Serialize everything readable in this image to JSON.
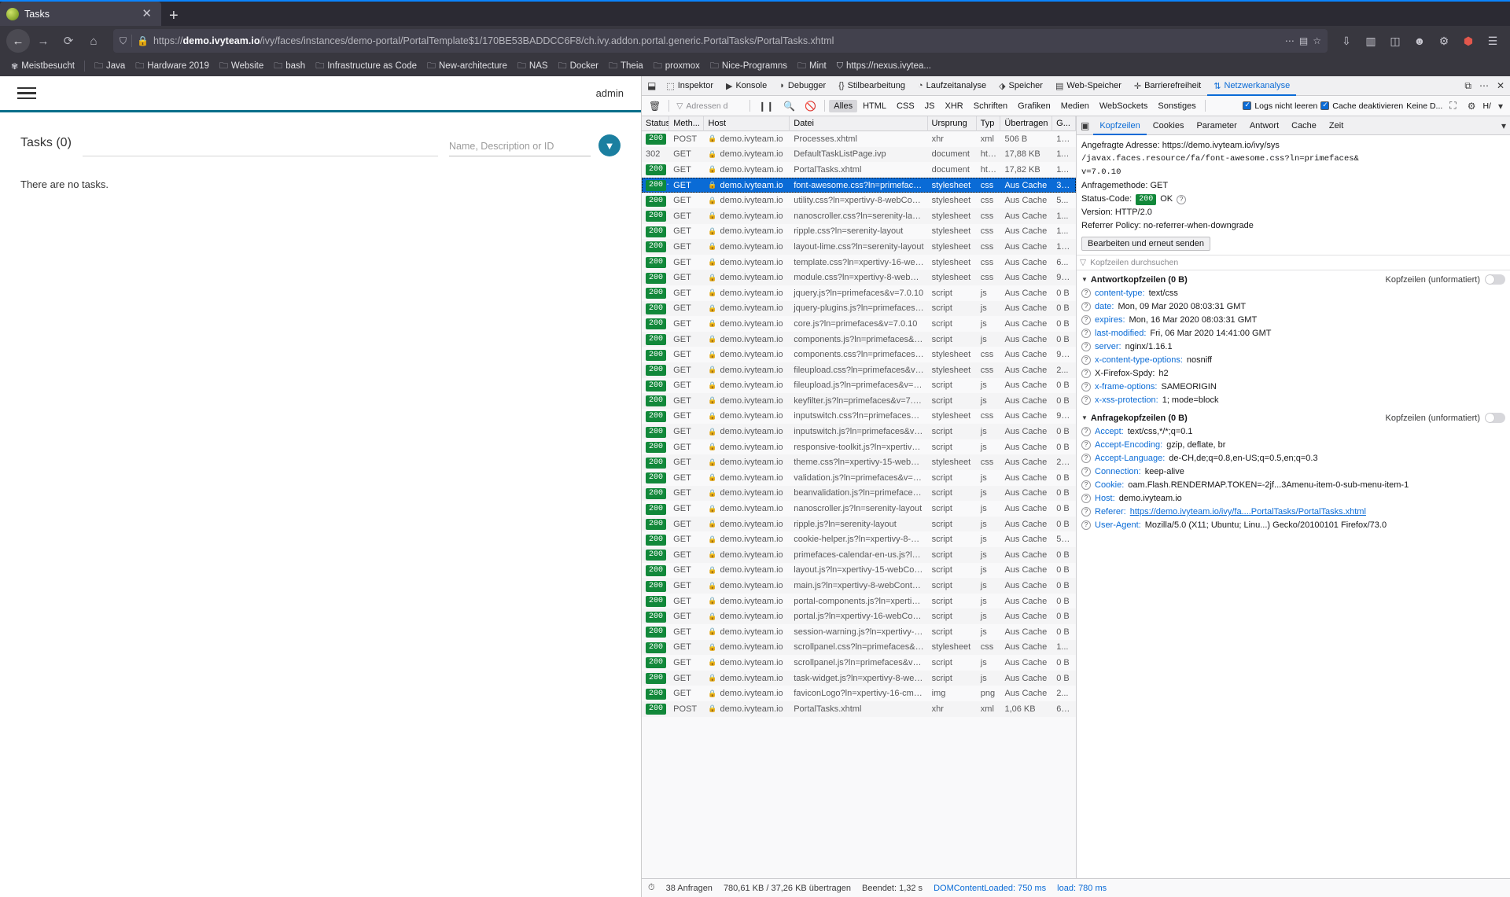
{
  "browser": {
    "tab": {
      "title": "Tasks",
      "close": "✕"
    },
    "new_tab": "+",
    "url": {
      "host": "demo.ivyteam.io",
      "scheme": "https://",
      "path": "/ivy/faces/instances/demo-portal/PortalTemplate$1/170BE53BADDCC6F8/ch.ivy.addon.portal.generic.PortalTasks/PortalTasks.xhtml"
    },
    "bookmarks": [
      {
        "label": "Meistbesucht",
        "icon": "gear-icon"
      },
      {
        "label": "Java",
        "icon": "folder-icon"
      },
      {
        "label": "Hardware 2019",
        "icon": "folder-icon"
      },
      {
        "label": "Website",
        "icon": "folder-icon"
      },
      {
        "label": "bash",
        "icon": "folder-icon"
      },
      {
        "label": "Infrastructure as Code",
        "icon": "folder-icon"
      },
      {
        "label": "New-architecture",
        "icon": "folder-icon"
      },
      {
        "label": "NAS",
        "icon": "folder-icon"
      },
      {
        "label": "Docker",
        "icon": "folder-icon"
      },
      {
        "label": "Theia",
        "icon": "folder-icon"
      },
      {
        "label": "proxmox",
        "icon": "folder-icon"
      },
      {
        "label": "Nice-Programns",
        "icon": "folder-icon"
      },
      {
        "label": "Mint",
        "icon": "folder-icon"
      },
      {
        "label": "https://nexus.ivytea...",
        "icon": "shield-icon"
      }
    ]
  },
  "page": {
    "user": "admin",
    "task_title": "Tasks (0)",
    "filter_placeholder": "Name, Description or ID",
    "empty_message": "There are no tasks."
  },
  "devtools": {
    "tabs": [
      {
        "label": "Inspektor",
        "icon": "inspector-icon",
        "selected": false
      },
      {
        "label": "Konsole",
        "icon": "console-icon",
        "selected": false
      },
      {
        "label": "Debugger",
        "icon": "debugger-icon",
        "selected": false
      },
      {
        "label": "Stilbearbeitung",
        "icon": "style-editor-icon",
        "selected": false
      },
      {
        "label": "Laufzeitanalyse",
        "icon": "performance-icon",
        "selected": false
      },
      {
        "label": "Speicher",
        "icon": "memory-icon",
        "selected": false
      },
      {
        "label": "Web-Speicher",
        "icon": "storage-icon",
        "selected": false
      },
      {
        "label": "Barrierefreiheit",
        "icon": "accessibility-icon",
        "selected": false
      },
      {
        "label": "Netzwerkanalyse",
        "icon": "network-icon",
        "selected": true
      }
    ],
    "toolbar": {
      "clear_icon": "trash-icon",
      "filter_placeholder": "Adressen d",
      "pause_icon": "pause-icon",
      "search_icon": "search-icon",
      "block_icon": "block-icon",
      "type_filters": [
        "Alles",
        "HTML",
        "CSS",
        "JS",
        "XHR",
        "Schriften",
        "Grafiken",
        "Medien",
        "WebSockets",
        "Sonstiges"
      ],
      "selected_filter": "Alles",
      "no_cache_label": "Logs nicht leeren",
      "disable_cache_label": "Cache deaktivieren",
      "throttle_label": "Keine D...",
      "screenshot_icon": "camera-icon",
      "settings_icon": "gear-icon",
      "dock_label": "H/",
      "close_icon": "close-icon"
    },
    "columns": [
      "Status",
      "Meth...",
      "Host",
      "Datei",
      "Ursprung",
      "Typ",
      "Übertragen",
      "G..."
    ],
    "requests": [
      {
        "status": "200",
        "ok": true,
        "method": "POST",
        "host": "demo.ivyteam.io",
        "file": "Processes.xhtml",
        "origin": "xhr",
        "type": "xml",
        "transferred": "506 B",
        "size": "14...",
        "selected": false
      },
      {
        "status": "302",
        "ok": false,
        "method": "GET",
        "host": "demo.ivyteam.io",
        "file": "DefaultTaskListPage.ivp",
        "origin": "document",
        "type": "html",
        "transferred": "17,88 KB",
        "size": "11...",
        "selected": false
      },
      {
        "status": "200",
        "ok": true,
        "method": "GET",
        "host": "demo.ivyteam.io",
        "file": "PortalTasks.xhtml",
        "origin": "document",
        "type": "html",
        "transferred": "17,82 KB",
        "size": "11...",
        "selected": false
      },
      {
        "status": "200",
        "ok": true,
        "method": "GET",
        "host": "demo.ivyteam.io",
        "file": "font-awesome.css?ln=primefaces&v=7...",
        "origin": "stylesheet",
        "type": "css",
        "transferred": "Aus Cache",
        "size": "30...",
        "selected": true
      },
      {
        "status": "200",
        "ok": true,
        "method": "GET",
        "host": "demo.ivyteam.io",
        "file": "utility.css?ln=xpertivy-8-webContent&x...",
        "origin": "stylesheet",
        "type": "css",
        "transferred": "Aus Cache",
        "size": "5...",
        "selected": false
      },
      {
        "status": "200",
        "ok": true,
        "method": "GET",
        "host": "demo.ivyteam.io",
        "file": "nanoscroller.css?ln=serenity-layout",
        "origin": "stylesheet",
        "type": "css",
        "transferred": "Aus Cache",
        "size": "1...",
        "selected": false
      },
      {
        "status": "200",
        "ok": true,
        "method": "GET",
        "host": "demo.ivyteam.io",
        "file": "ripple.css?ln=serenity-layout",
        "origin": "stylesheet",
        "type": "css",
        "transferred": "Aus Cache",
        "size": "1...",
        "selected": false
      },
      {
        "status": "200",
        "ok": true,
        "method": "GET",
        "host": "demo.ivyteam.io",
        "file": "layout-lime.css?ln=serenity-layout",
        "origin": "stylesheet",
        "type": "css",
        "transferred": "Aus Cache",
        "size": "10...",
        "selected": false
      },
      {
        "status": "200",
        "ok": true,
        "method": "GET",
        "host": "demo.ivyteam.io",
        "file": "template.css?ln=xpertivy-16-webConte...",
        "origin": "stylesheet",
        "type": "css",
        "transferred": "Aus Cache",
        "size": "6...",
        "selected": false
      },
      {
        "status": "200",
        "ok": true,
        "method": "GET",
        "host": "demo.ivyteam.io",
        "file": "module.css?ln=xpertivy-8-webContent...",
        "origin": "stylesheet",
        "type": "css",
        "transferred": "Aus Cache",
        "size": "94...",
        "selected": false
      },
      {
        "status": "200",
        "ok": true,
        "method": "GET",
        "host": "demo.ivyteam.io",
        "file": "jquery.js?ln=primefaces&v=7.0.10",
        "origin": "script",
        "type": "js",
        "transferred": "Aus Cache",
        "size": "0 B",
        "selected": false
      },
      {
        "status": "200",
        "ok": true,
        "method": "GET",
        "host": "demo.ivyteam.io",
        "file": "jquery-plugins.js?ln=primefaces&v=7.0...",
        "origin": "script",
        "type": "js",
        "transferred": "Aus Cache",
        "size": "0 B",
        "selected": false
      },
      {
        "status": "200",
        "ok": true,
        "method": "GET",
        "host": "demo.ivyteam.io",
        "file": "core.js?ln=primefaces&v=7.0.10",
        "origin": "script",
        "type": "js",
        "transferred": "Aus Cache",
        "size": "0 B",
        "selected": false
      },
      {
        "status": "200",
        "ok": true,
        "method": "GET",
        "host": "demo.ivyteam.io",
        "file": "components.js?ln=primefaces&v=7.0.10",
        "origin": "script",
        "type": "js",
        "transferred": "Aus Cache",
        "size": "0 B",
        "selected": false
      },
      {
        "status": "200",
        "ok": true,
        "method": "GET",
        "host": "demo.ivyteam.io",
        "file": "components.css?ln=primefaces&v=7.0...",
        "origin": "stylesheet",
        "type": "css",
        "transferred": "Aus Cache",
        "size": "91...",
        "selected": false
      },
      {
        "status": "200",
        "ok": true,
        "method": "GET",
        "host": "demo.ivyteam.io",
        "file": "fileupload.css?ln=primefaces&v=7.0.10",
        "origin": "stylesheet",
        "type": "css",
        "transferred": "Aus Cache",
        "size": "2...",
        "selected": false
      },
      {
        "status": "200",
        "ok": true,
        "method": "GET",
        "host": "demo.ivyteam.io",
        "file": "fileupload.js?ln=primefaces&v=7.0.10",
        "origin": "script",
        "type": "js",
        "transferred": "Aus Cache",
        "size": "0 B",
        "selected": false
      },
      {
        "status": "200",
        "ok": true,
        "method": "GET",
        "host": "demo.ivyteam.io",
        "file": "keyfilter.js?ln=primefaces&v=7.0.10",
        "origin": "script",
        "type": "js",
        "transferred": "Aus Cache",
        "size": "0 B",
        "selected": false
      },
      {
        "status": "200",
        "ok": true,
        "method": "GET",
        "host": "demo.ivyteam.io",
        "file": "inputswitch.css?ln=primefaces&v=7.0.10",
        "origin": "stylesheet",
        "type": "css",
        "transferred": "Aus Cache",
        "size": "99...",
        "selected": false
      },
      {
        "status": "200",
        "ok": true,
        "method": "GET",
        "host": "demo.ivyteam.io",
        "file": "inputswitch.js?ln=primefaces&v=7.0.10",
        "origin": "script",
        "type": "js",
        "transferred": "Aus Cache",
        "size": "0 B",
        "selected": false
      },
      {
        "status": "200",
        "ok": true,
        "method": "GET",
        "host": "demo.ivyteam.io",
        "file": "responsive-toolkit.js?ln=xpertivy-16-we...",
        "origin": "script",
        "type": "js",
        "transferred": "Aus Cache",
        "size": "0 B",
        "selected": false
      },
      {
        "status": "200",
        "ok": true,
        "method": "GET",
        "host": "demo.ivyteam.io",
        "file": "theme.css?ln=xpertivy-15-webContent...",
        "origin": "stylesheet",
        "type": "css",
        "transferred": "Aus Cache",
        "size": "20...",
        "selected": false
      },
      {
        "status": "200",
        "ok": true,
        "method": "GET",
        "host": "demo.ivyteam.io",
        "file": "validation.js?ln=primefaces&v=7.0.10",
        "origin": "script",
        "type": "js",
        "transferred": "Aus Cache",
        "size": "0 B",
        "selected": false
      },
      {
        "status": "200",
        "ok": true,
        "method": "GET",
        "host": "demo.ivyteam.io",
        "file": "beanvalidation.js?ln=primefaces&v=7....",
        "origin": "script",
        "type": "js",
        "transferred": "Aus Cache",
        "size": "0 B",
        "selected": false
      },
      {
        "status": "200",
        "ok": true,
        "method": "GET",
        "host": "demo.ivyteam.io",
        "file": "nanoscroller.js?ln=serenity-layout",
        "origin": "script",
        "type": "js",
        "transferred": "Aus Cache",
        "size": "0 B",
        "selected": false
      },
      {
        "status": "200",
        "ok": true,
        "method": "GET",
        "host": "demo.ivyteam.io",
        "file": "ripple.js?ln=serenity-layout",
        "origin": "script",
        "type": "js",
        "transferred": "Aus Cache",
        "size": "0 B",
        "selected": false
      },
      {
        "status": "200",
        "ok": true,
        "method": "GET",
        "host": "demo.ivyteam.io",
        "file": "cookie-helper.js?ln=xpertivy-8-webCon...",
        "origin": "script",
        "type": "js",
        "transferred": "Aus Cache",
        "size": "51...",
        "selected": false
      },
      {
        "status": "200",
        "ok": true,
        "method": "GET",
        "host": "demo.ivyteam.io",
        "file": "primefaces-calendar-en-us.js?ln=xperti...",
        "origin": "script",
        "type": "js",
        "transferred": "Aus Cache",
        "size": "0 B",
        "selected": false
      },
      {
        "status": "200",
        "ok": true,
        "method": "GET",
        "host": "demo.ivyteam.io",
        "file": "layout.js?ln=xpertivy-15-webContent&...",
        "origin": "script",
        "type": "js",
        "transferred": "Aus Cache",
        "size": "0 B",
        "selected": false
      },
      {
        "status": "200",
        "ok": true,
        "method": "GET",
        "host": "demo.ivyteam.io",
        "file": "main.js?ln=xpertivy-8-webContent&xv...",
        "origin": "script",
        "type": "js",
        "transferred": "Aus Cache",
        "size": "0 B",
        "selected": false
      },
      {
        "status": "200",
        "ok": true,
        "method": "GET",
        "host": "demo.ivyteam.io",
        "file": "portal-components.js?ln=xpertivy-16-w...",
        "origin": "script",
        "type": "js",
        "transferred": "Aus Cache",
        "size": "0 B",
        "selected": false
      },
      {
        "status": "200",
        "ok": true,
        "method": "GET",
        "host": "demo.ivyteam.io",
        "file": "portal.js?ln=xpertivy-16-webContent&x...",
        "origin": "script",
        "type": "js",
        "transferred": "Aus Cache",
        "size": "0 B",
        "selected": false
      },
      {
        "status": "200",
        "ok": true,
        "method": "GET",
        "host": "demo.ivyteam.io",
        "file": "session-warning.js?ln=xpertivy-9-webC...",
        "origin": "script",
        "type": "js",
        "transferred": "Aus Cache",
        "size": "0 B",
        "selected": false
      },
      {
        "status": "200",
        "ok": true,
        "method": "GET",
        "host": "demo.ivyteam.io",
        "file": "scrollpanel.css?ln=primefaces&v=7.0.10",
        "origin": "stylesheet",
        "type": "css",
        "transferred": "Aus Cache",
        "size": "1...",
        "selected": false
      },
      {
        "status": "200",
        "ok": true,
        "method": "GET",
        "host": "demo.ivyteam.io",
        "file": "scrollpanel.js?ln=primefaces&v=7.0.10",
        "origin": "script",
        "type": "js",
        "transferred": "Aus Cache",
        "size": "0 B",
        "selected": false
      },
      {
        "status": "200",
        "ok": true,
        "method": "GET",
        "host": "demo.ivyteam.io",
        "file": "task-widget.js?ln=xpertivy-8-webConte...",
        "origin": "script",
        "type": "js",
        "transferred": "Aus Cache",
        "size": "0 B",
        "selected": false
      },
      {
        "status": "200",
        "ok": true,
        "method": "GET",
        "host": "demo.ivyteam.io",
        "file": "faviconLogo?ln=xpertivy-16-cms&xv=1...",
        "origin": "img",
        "type": "png",
        "transferred": "Aus Cache",
        "size": "2...",
        "selected": false
      },
      {
        "status": "200",
        "ok": true,
        "method": "POST",
        "host": "demo.ivyteam.io",
        "file": "PortalTasks.xhtml",
        "origin": "xhr",
        "type": "xml",
        "transferred": "1,06 KB",
        "size": "69...",
        "selected": false
      }
    ],
    "status_bar": {
      "clock_icon": "clock-icon",
      "request_count": "38 Anfragen",
      "transferred": "780,61 KB / 37,26 KB übertragen",
      "finish": "Beendet: 1,32 s",
      "dom_content_loaded": "DOMContentLoaded: 750 ms",
      "load": "load: 780 ms"
    },
    "details": {
      "play_icon": "play-icon",
      "tabs": [
        "Kopfzeilen",
        "Cookies",
        "Parameter",
        "Antwort",
        "Cache",
        "Zeit"
      ],
      "selected_tab": "Kopfzeilen",
      "requested_address_label": "Angefragte Adresse:",
      "requested_address_value": "https://demo.ivyteam.io/ivy/sys",
      "requested_address_line2": "/javax.faces.resource/fa/font-awesome.css?ln=primefaces&",
      "requested_address_line3": "v=7.0.10",
      "request_method_label": "Anfragemethode:",
      "request_method_value": "GET",
      "status_code_label": "Status-Code:",
      "status_code_value": "200",
      "status_code_ok": "OK",
      "version_label": "Version:",
      "version_value": "HTTP/2.0",
      "referrer_policy_label": "Referrer Policy:",
      "referrer_policy_value": "no-referrer-when-downgrade",
      "resend_button": "Bearbeiten und erneut senden",
      "search_placeholder": "Kopfzeilen durchsuchen",
      "response_section": "Antwortkopfzeilen (0 B)",
      "request_section": "Anfragekopfzeilen (0 B)",
      "raw_label": "Kopfzeilen (unformatiert)",
      "response_headers": [
        {
          "name": "content-type:",
          "value": "text/css",
          "link": true,
          "plain_value": true
        },
        {
          "name": "date:",
          "value": "Mon, 09 Mar 2020 08:03:31 GMT",
          "link": true,
          "plain_value": true
        },
        {
          "name": "expires:",
          "value": "Mon, 16 Mar 2020 08:03:31 GMT",
          "link": true,
          "plain_value": true
        },
        {
          "name": "last-modified:",
          "value": "Fri, 06 Mar 2020 14:41:00 GMT",
          "link": true,
          "plain_value": true
        },
        {
          "name": "server:",
          "value": "nginx/1.16.1",
          "link": true,
          "plain_value": true
        },
        {
          "name": "x-content-type-options:",
          "value": "nosniff",
          "link": true,
          "plain_value": true
        },
        {
          "name": "X-Firefox-Spdy:",
          "value": "h2",
          "link": false,
          "plain_value": true
        },
        {
          "name": "x-frame-options:",
          "value": "SAMEORIGIN",
          "link": true,
          "plain_value": true
        },
        {
          "name": "x-xss-protection:",
          "value": "1; mode=block",
          "link": true,
          "plain_value": true
        }
      ],
      "request_headers": [
        {
          "name": "Accept:",
          "value": "text/css,*/*;q=0.1",
          "link": true,
          "plain_value": true
        },
        {
          "name": "Accept-Encoding:",
          "value": "gzip, deflate, br",
          "link": true,
          "plain_value": true
        },
        {
          "name": "Accept-Language:",
          "value": "de-CH,de;q=0.8,en-US;q=0.5,en;q=0.3",
          "link": true,
          "plain_value": true
        },
        {
          "name": "Connection:",
          "value": "keep-alive",
          "link": true,
          "plain_value": true
        },
        {
          "name": "Cookie:",
          "value": "oam.Flash.RENDERMAP.TOKEN=-2jf...3Amenu-item-0-sub-menu-item-1",
          "link": true,
          "plain_value": true
        },
        {
          "name": "Host:",
          "value": "demo.ivyteam.io",
          "link": true,
          "plain_value": true
        },
        {
          "name": "Referer:",
          "value": "https://demo.ivyteam.io/ivy/fa....PortalTasks/PortalTasks.xhtml",
          "link": true,
          "plain_value": false
        },
        {
          "name": "User-Agent:",
          "value": "Mozilla/5.0 (X11; Ubuntu; Linu...) Gecko/20100101 Firefox/73.0",
          "link": true,
          "plain_value": true
        }
      ]
    }
  }
}
